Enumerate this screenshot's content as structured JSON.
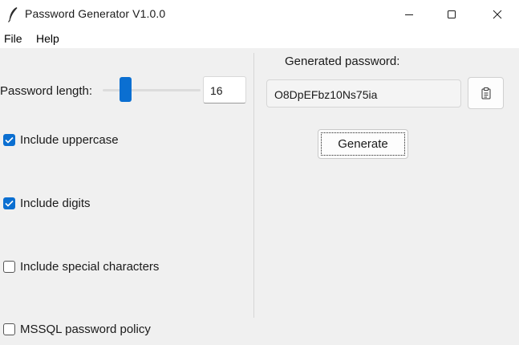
{
  "window": {
    "title": "Password Generator V1.0.0",
    "app_icon": "feather-icon",
    "controls": [
      "minimize-icon",
      "maximize-icon",
      "close-icon"
    ]
  },
  "menu": {
    "file": "File",
    "help": "Help"
  },
  "options": {
    "length_label": "Password length:",
    "length_value": "16",
    "length_slider_fraction": 0.2,
    "checkboxes": [
      {
        "label": "Include uppercase",
        "checked": true
      },
      {
        "label": "Include digits",
        "checked": true
      },
      {
        "label": "Include special characters",
        "checked": false
      },
      {
        "label": "MSSQL password policy",
        "checked": false
      }
    ]
  },
  "output": {
    "label": "Generated password:",
    "password": "O8DpEFbz10Ns75ia",
    "copy_icon": "clipboard-icon",
    "generate_label": "Generate"
  },
  "colors": {
    "accent": "#0b6fd1",
    "window_bg": "#f0f0f0",
    "titlebar_bg": "#ffffff"
  }
}
